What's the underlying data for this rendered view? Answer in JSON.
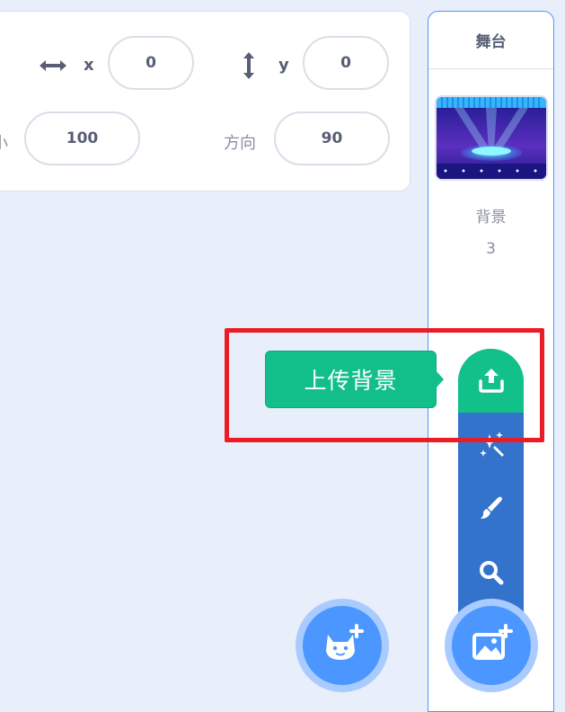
{
  "sprite_info": {
    "x_label": "x",
    "x_value": "0",
    "y_label": "y",
    "y_value": "0",
    "size_label": "小",
    "size_value": "100",
    "direction_label": "方向",
    "direction_value": "90"
  },
  "stage": {
    "title": "舞台",
    "backdrop_label": "背景",
    "backdrop_count": "3"
  },
  "backdrop_menu": {
    "tooltip": "上传背景",
    "items": [
      "upload-icon",
      "surprise-icon",
      "paint-icon",
      "search-icon"
    ]
  },
  "fabs": {
    "sprite": "cat-add-icon",
    "backdrop": "backdrop-add-icon"
  },
  "colors": {
    "accent": "#4c97ff",
    "menu_blue": "#3373cc",
    "green": "#12c08a",
    "highlight": "#ec1c24"
  }
}
